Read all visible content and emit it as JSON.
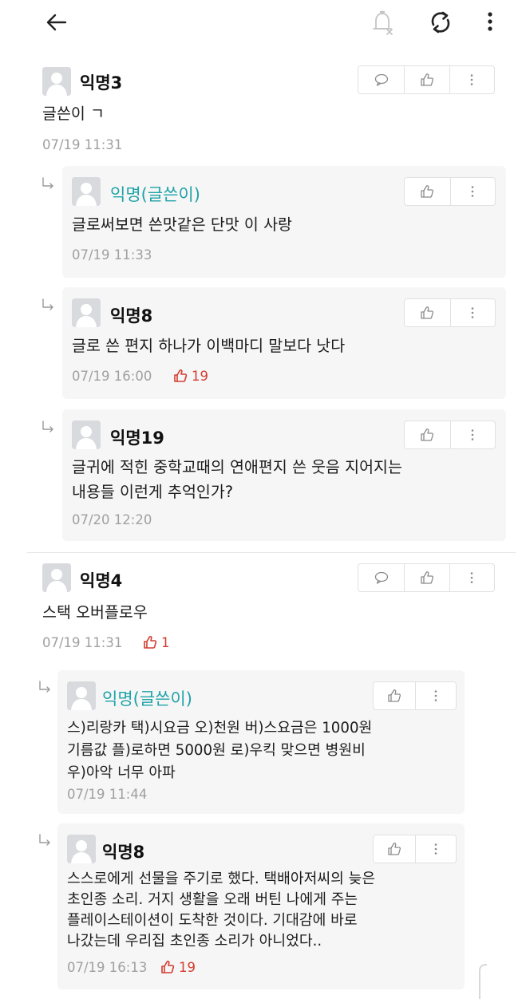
{
  "topbar": {
    "back_icon": "back-arrow-icon",
    "bell_icon": "notification-off-icon",
    "refresh_icon": "refresh-icon",
    "more_icon": "more-vertical-icon"
  },
  "comments": [
    {
      "author": "익명3",
      "body": [
        "글쓴이 ㄱ"
      ],
      "time": "07/19 11:31",
      "replies": [
        {
          "author": "익명(글쓴이)",
          "body": [
            "글로써보면 쓴맛같은 단맛 이 사랑"
          ],
          "time": "07/19 11:33",
          "likes": null
        },
        {
          "author": "익명8",
          "body": [
            "글로 쓴 편지 하나가 이백마디 말보다 낫다"
          ],
          "time": "07/19 16:00",
          "likes": "19"
        },
        {
          "author": "익명19",
          "body": [
            "글귀에 적힌 중학교때의 연애편지 쓴 웃음 지어지는",
            "내용들  이런게 추억인가?"
          ],
          "time": "07/20 12:20",
          "likes": null
        }
      ]
    },
    {
      "author": "익명4",
      "body": [
        "스택 오버플로우"
      ],
      "time": "07/19 11:31",
      "likes": "1",
      "replies": [
        {
          "author": "익명(글쓴이)",
          "body": [
            "스)리랑카 택)시요금 오)천원 버)스요금은 1000원",
            "기름값 플)로하면 5000원 로)우킥 맞으면 병원비",
            "우)아악 너무 아파"
          ],
          "time": "07/19 11:44",
          "likes": null
        },
        {
          "author": "익명8",
          "body": [
            "스스로에게 선물을 주기로 했다. 택배아저씨의 늦은",
            "초인종 소리. 거지 생활을 오래 버틴 나에게 주는",
            "플레이스테이션이 도착한 것이다. 기대감에 바로",
            "나갔는데 우리집 초인종 소리가 아니었다.."
          ],
          "time": "07/19 16:13",
          "likes": "19"
        }
      ]
    }
  ],
  "colors": {
    "writer": "#1fa3a8",
    "likes": "#d23d2f",
    "meta": "#a0a0a0",
    "reply_bg": "#f6f6f6"
  }
}
